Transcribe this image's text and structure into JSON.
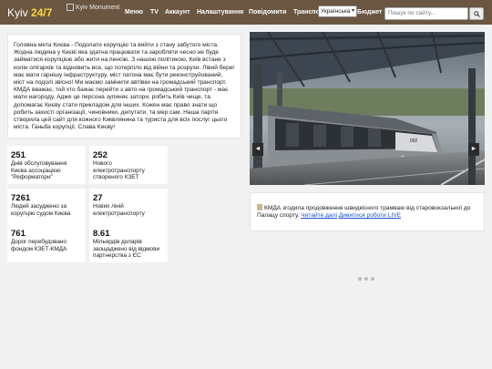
{
  "header": {
    "logo_main": "Kyiv ",
    "logo_accent": "24/7",
    "brand_image_alt": "Kyiv Monument",
    "nav": [
      "Меню",
      "TV",
      "Аккаунт",
      "Налаштування",
      "Повідомити",
      "Транспорт",
      "Бюджет"
    ],
    "language": "Українська",
    "search_placeholder": "Пошук по сайту..."
  },
  "mission": {
    "text": "Головна мета Києва - Подолати корупцію та вийти з стану забутого міста. Жодна людина у Києві яка здатна працювати та заробляти чесно не буде займатися корупцією або жити на пенсію. З нашою політикою, Київ встане з колін олігархів та відновить все, що потерпіло від війни та розрухи. Лівий берег має мати гарнішу інфраструктуру, міст патона має бути реконструйований, міст на подолі звісно! Ми маємо замінити автівки на громадський транспорт. КМДА вважає, той хто бажає перейти з авто на громадський транспорт - має мати нагороду. Адже це персона зупиняє затори, робить Київ чище, та допомагає Києву стати прикладом для інших. Кожен має право знати що робить захисті організації, чиновники, депутати, та мер сам. Наша партія створила цей сайт для кожного Киквлянина та туриста для всіх послуг цього міста. Ганьба корупції, Слава Києву!"
  },
  "stats": [
    {
      "value": "251",
      "label": "Днів обслуговування Києва ассоціацією \"Реформатори\""
    },
    {
      "value": "252",
      "label": "Нового електротранспорту створеного КЗЕТ"
    },
    {
      "value": "7261",
      "label": "Людей засуджено за корупцію судом Києва"
    },
    {
      "value": "27",
      "label": "Нових ліній електротранспорту"
    },
    {
      "value": "761",
      "label": "Дорог перебудовано фондом КЗЕТ-КМДА"
    },
    {
      "value": "8.61",
      "label": "Мільярдів доларів заощаджено від відмови партнерства з ЄС"
    }
  ],
  "slider": {
    "tram_number": "002",
    "prev_label": "◄",
    "next_label": "►"
  },
  "news": {
    "text": "КМДА згодила продовження швидкісного трамваю від старовокзальної до Палацу спорту.",
    "link_read": "Читайте далі",
    "link_watch": "Дивитися роботи LIVE"
  }
}
